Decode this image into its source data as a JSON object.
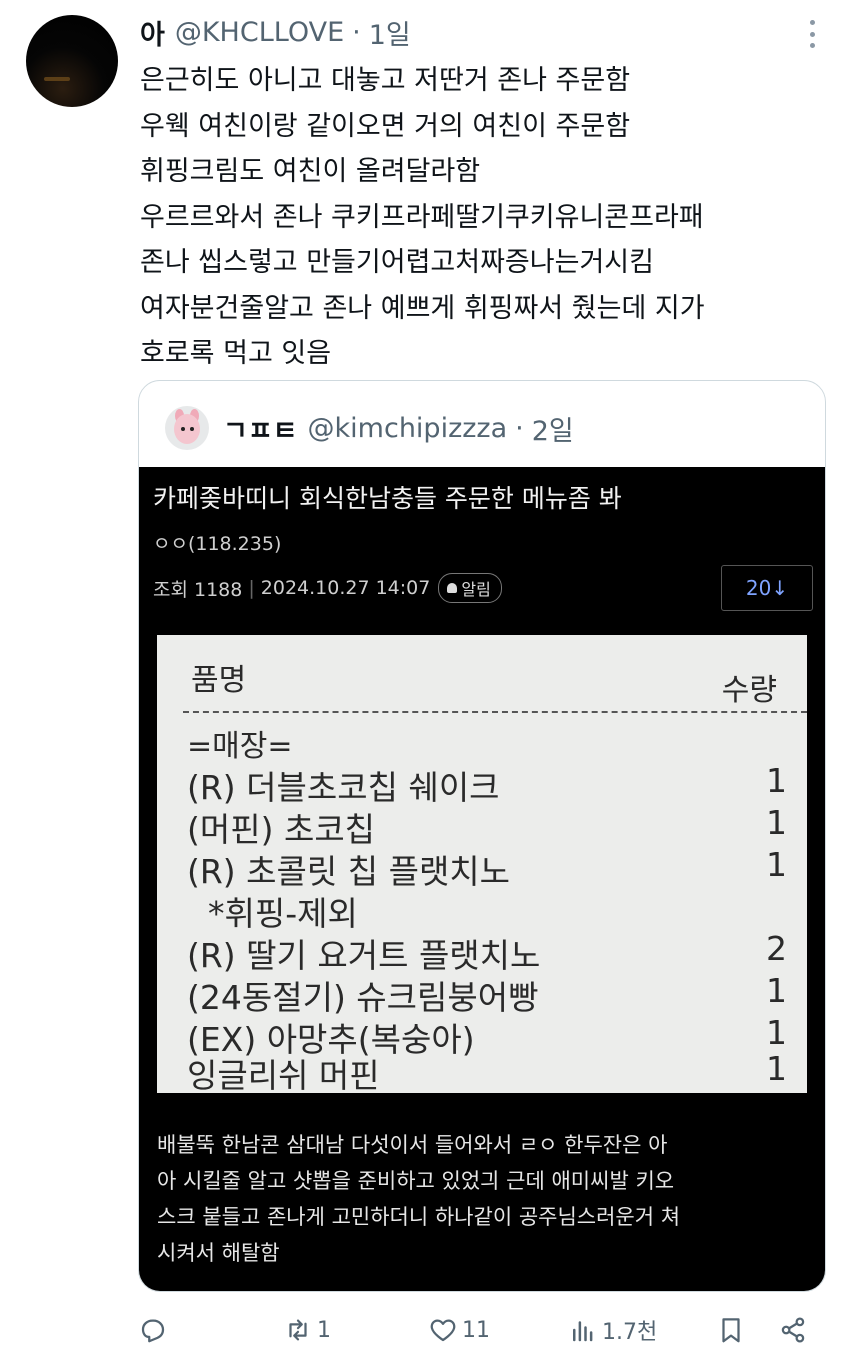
{
  "tweet": {
    "display_name": "아",
    "handle": "@KHCLLOVE",
    "separator": "·",
    "time": "1일",
    "lines": [
      "은근히도 아니고 대놓고 저딴거 존나 주문함",
      "우웩 여친이랑 같이오면 거의 여친이 주문함",
      "휘핑크림도 여친이 올려달라함",
      "우르르와서 존나 쿠키프라페딸기쿠키유니콘프라패",
      "존나 씹스렇고 만들기어렵고처짜증나는거시킴",
      "여자분건줄알고 존나 예쁘게 휘핑짜서 줬는데 지가",
      "호로록 먹고 잇음"
    ]
  },
  "quote": {
    "display_name": "ㄱㅍㅌ",
    "handle": "@kimchipizzza",
    "separator": "·",
    "time": "2일",
    "post": {
      "title": "카페좆바띠니 회식한남충들 주문한 메뉴좀 봐",
      "author": "ㅇㅇ(118.235)",
      "views": "조회 1188",
      "meta_sep": "|",
      "datetime": "2024.10.27 14:07",
      "alarm": "알림",
      "comments": "20↓",
      "receipt": {
        "col_item": "품명",
        "col_qty": "수량",
        "section": "=매장=",
        "rows": [
          {
            "item": "(R) 더블초코칩 쉐이크",
            "qty": "1"
          },
          {
            "item": "(머핀) 초코칩",
            "qty": "1"
          },
          {
            "item": "(R) 초콜릿 칩 플랫치노",
            "qty": "1"
          },
          {
            "item": "  *휘핑-제외",
            "qty": ""
          },
          {
            "item": "(R) 딸기 요거트 플랫치노",
            "qty": "2"
          },
          {
            "item": "(24동절기) 슈크림붕어빵",
            "qty": "1"
          },
          {
            "item": "(EX) 아망추(복숭아)",
            "qty": "1"
          },
          {
            "item": "잉글리쉬 머핀",
            "qty": "1"
          }
        ]
      },
      "body_lines": [
        "배불뚝 한남콘 삼대남 다섯이서 들어와서 ㄹㅇ 한두잔은 아",
        "아 시킬줄 알고 샷뽑을 준비하고 있었긔 근데 애미씨발 키오",
        "스크 붙들고 존나게 고민하더니 하나같이 공주님스러운거 쳐",
        "시켜서 해탈함"
      ]
    }
  },
  "actions": {
    "reply_count": "",
    "retweet_count": "1",
    "like_count": "11",
    "views_count": "1.7천"
  },
  "colors": {
    "muted": "#536471",
    "border": "#cfd9de",
    "link_blue": "#7fa3ff"
  }
}
